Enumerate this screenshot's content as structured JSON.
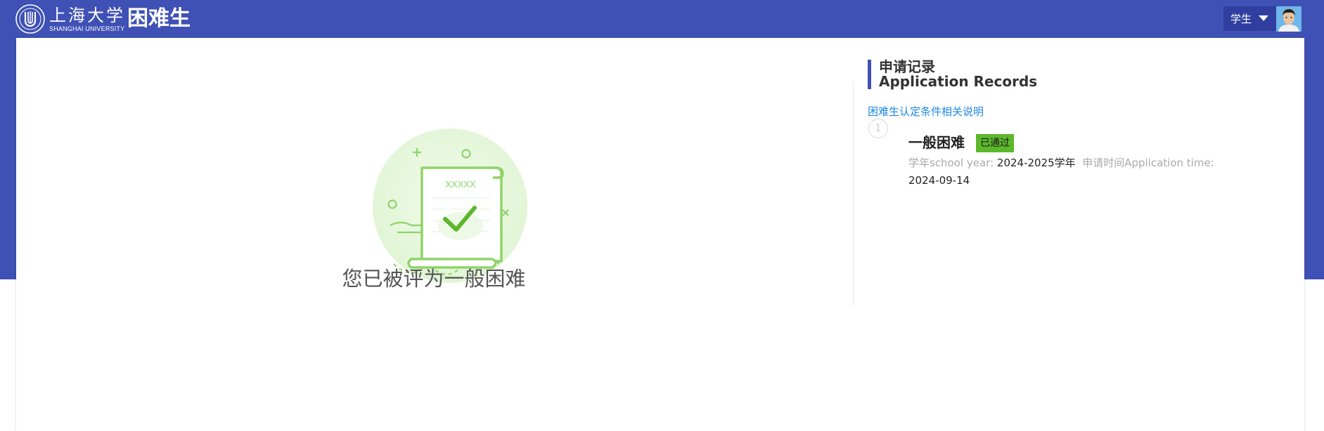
{
  "header": {
    "logo_cn": "上海大学",
    "logo_en": "SHANGHAI UNIVERSITY",
    "app_title": "困难生",
    "role": "学生",
    "brand_color": "#3f51b5"
  },
  "main": {
    "certificate_text": "XXXXX",
    "result_message": "您已被评为一般困难"
  },
  "records": {
    "title_cn": "申请记录",
    "title_en": "Application Records",
    "criteria_link": "困难生认定条件相关说明",
    "items": [
      {
        "index": "1",
        "title": "一般困难",
        "status": "已通过",
        "status_color": "#5cb72a",
        "school_year_label": "学年school year:",
        "school_year": "2024-2025学年",
        "apply_time_label": "申请时间Application time:",
        "apply_time": "2024-09-14"
      }
    ]
  },
  "icons": [
    "university-logo-icon",
    "chevron-down-icon",
    "avatar",
    "certificate-check-icon"
  ]
}
